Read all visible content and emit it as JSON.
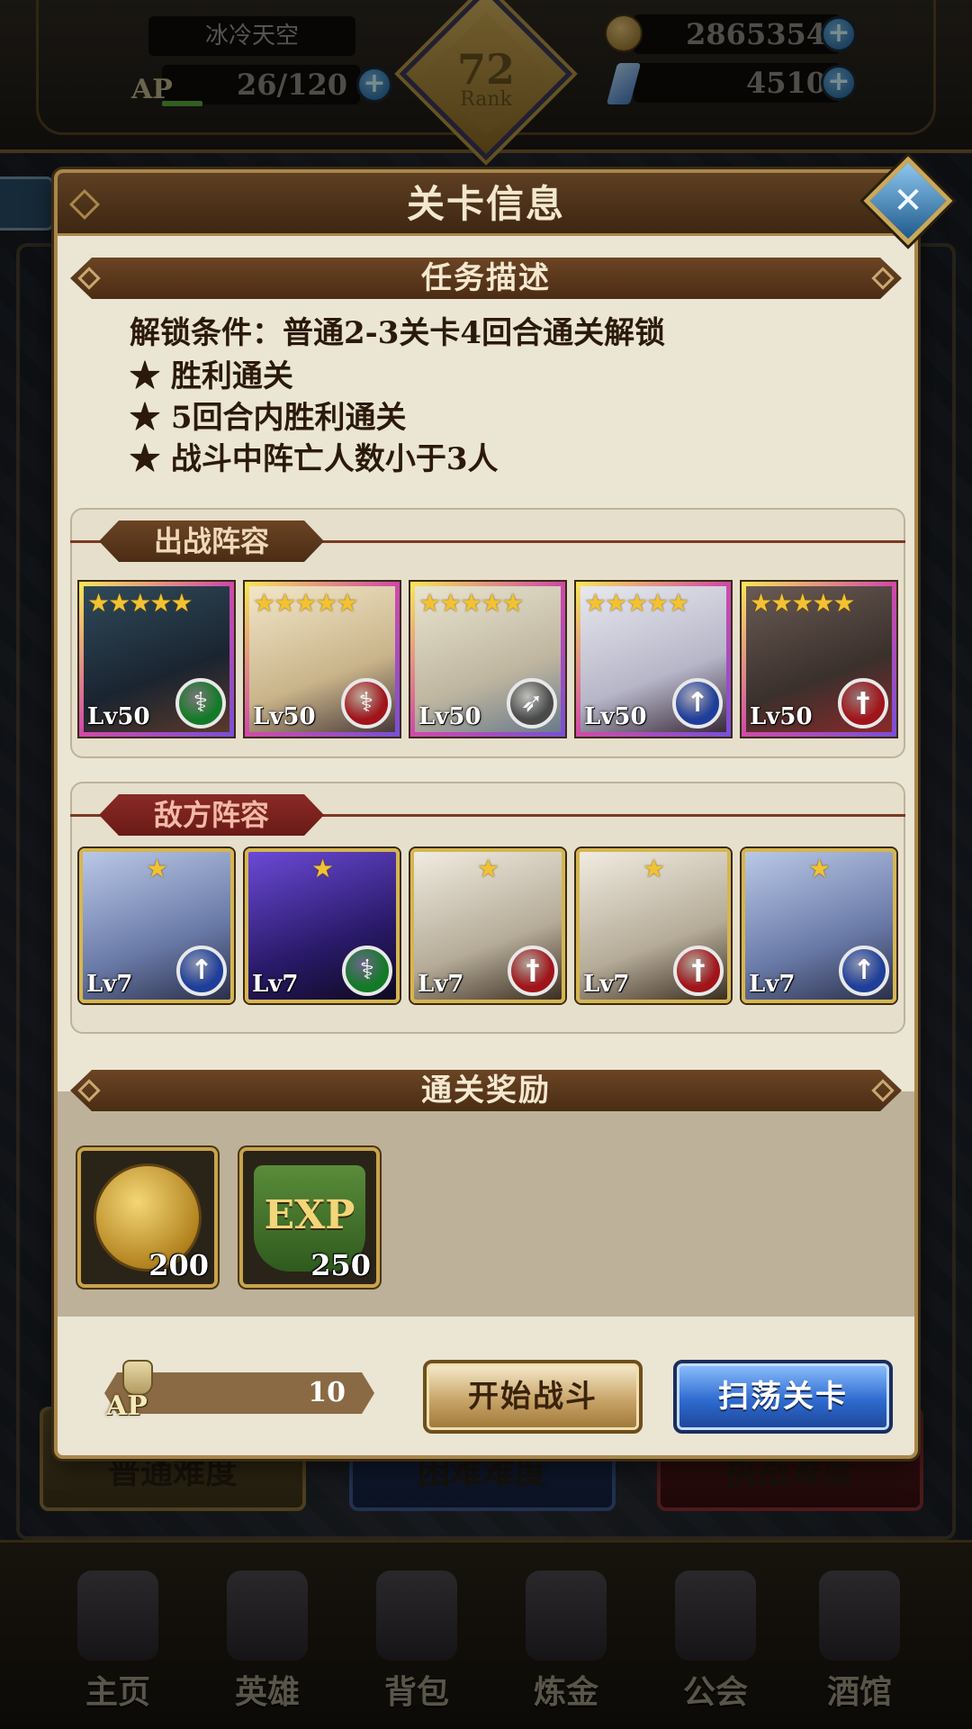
{
  "topbar": {
    "player_name": "冰冷天空",
    "ap_label": "AP",
    "ap_value": "26/120",
    "rank_value": "72",
    "rank_label": "Rank",
    "gold_value": "2865354",
    "gem_value": "4510",
    "plus_glyph": "+"
  },
  "background": {
    "difficulty_buttons": [
      "普通难度",
      "困难难度",
      "挑战难度"
    ],
    "nav": [
      "主页",
      "英雄",
      "背包",
      "炼金",
      "公会",
      "酒馆"
    ]
  },
  "modal": {
    "title": "关卡信息",
    "close_glyph": "✕",
    "task_section": "任务描述",
    "unlock_condition": "解锁条件：普通2-3关卡4回合通关解锁",
    "objectives": [
      "★ 胜利通关",
      "★ 5回合内胜利通关",
      "★ 战斗中阵亡人数小于3人"
    ],
    "ally_section": "出战阵容",
    "enemy_section": "敌方阵容",
    "allies": [
      {
        "stars": "★★★★★",
        "level": "Lv50",
        "class_icon": "staff-icon",
        "class_color": "#137a28",
        "glyph": "⚕"
      },
      {
        "stars": "★★★★★",
        "level": "Lv50",
        "class_icon": "staff-icon",
        "class_color": "#a0141a",
        "glyph": "⚕"
      },
      {
        "stars": "★★★★★",
        "level": "Lv50",
        "class_icon": "bow-icon",
        "class_color": "#4a4a4a",
        "glyph": "➶"
      },
      {
        "stars": "★★★★★",
        "level": "Lv50",
        "class_icon": "spear-icon",
        "class_color": "#1e3e9a",
        "glyph": "↑"
      },
      {
        "stars": "★★★★★",
        "level": "Lv50",
        "class_icon": "sword-icon",
        "class_color": "#a0141a",
        "glyph": "†"
      }
    ],
    "enemies": [
      {
        "stars": "★",
        "level": "Lv7",
        "class_icon": "spear-icon",
        "class_color": "#1e3e9a",
        "glyph": "↑"
      },
      {
        "stars": "★",
        "level": "Lv7",
        "class_icon": "staff-icon",
        "class_color": "#137a28",
        "glyph": "⚕"
      },
      {
        "stars": "★",
        "level": "Lv7",
        "class_icon": "sword-icon",
        "class_color": "#a0141a",
        "glyph": "†"
      },
      {
        "stars": "★",
        "level": "Lv7",
        "class_icon": "sword-icon",
        "class_color": "#a0141a",
        "glyph": "†"
      },
      {
        "stars": "★",
        "level": "Lv7",
        "class_icon": "spear-icon",
        "class_color": "#1e3e9a",
        "glyph": "↑"
      }
    ],
    "reward_section": "通关奖励",
    "rewards": [
      {
        "type": "gold",
        "count": "200"
      },
      {
        "type": "exp",
        "label": "EXP",
        "count": "250"
      }
    ],
    "ap_cost_label": "AP",
    "ap_cost_value": "10",
    "start_button": "开始战斗",
    "sweep_button": "扫荡关卡"
  },
  "colors": {
    "panel": "#ebe5d4",
    "title_bar": "#4e3019",
    "accent_gold": "#a8874a",
    "enemy_tab": "#8a2a26",
    "sweep_blue": "#2f6bd0"
  }
}
